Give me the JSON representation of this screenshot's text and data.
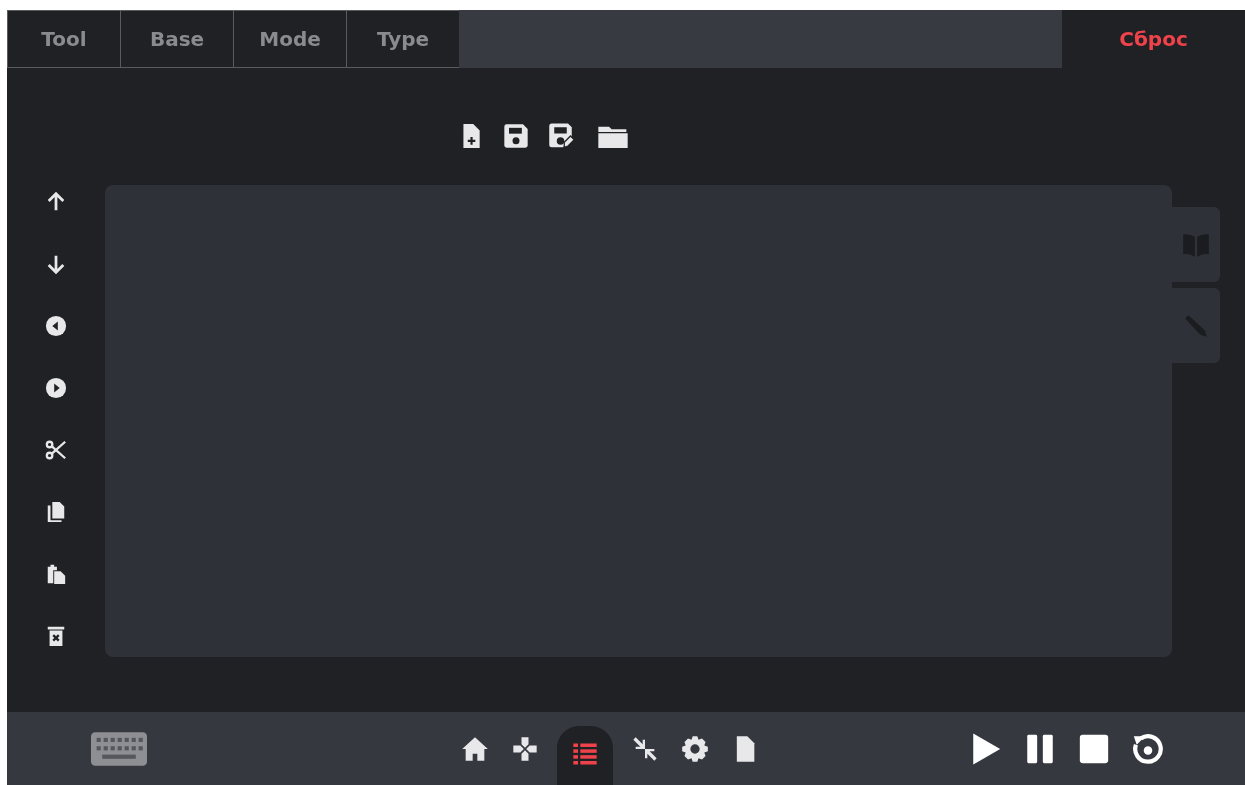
{
  "tabs": [
    {
      "label": "Tool",
      "selected": false
    },
    {
      "label": "Base",
      "selected": false
    },
    {
      "label": "Mode",
      "selected": false
    },
    {
      "label": "Type",
      "selected": false
    }
  ],
  "reset_button": {
    "label": "Сброс"
  },
  "nav": [
    {
      "kind": "home",
      "selected": false
    },
    {
      "kind": "dpad",
      "selected": false
    },
    {
      "kind": "list",
      "selected": true
    },
    {
      "kind": "compress",
      "selected": false
    },
    {
      "kind": "gear",
      "selected": false
    },
    {
      "kind": "file",
      "selected": false
    }
  ]
}
